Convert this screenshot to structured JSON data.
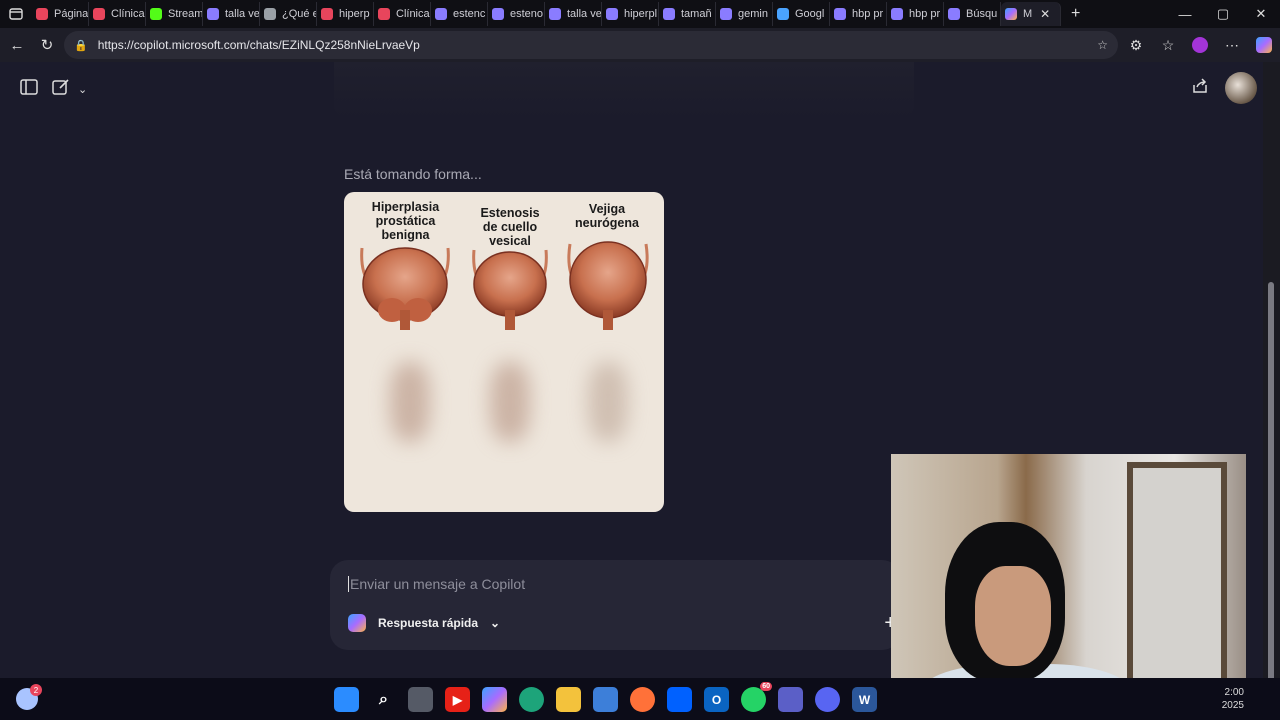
{
  "browser": {
    "tabs": [
      {
        "label": "Página",
        "color": "#e8455c"
      },
      {
        "label": "Clínica",
        "color": "#e8455c"
      },
      {
        "label": "Stream",
        "color": "#53fc18"
      },
      {
        "label": "talla ve",
        "color": "#8a7cff"
      },
      {
        "label": "¿Qué e",
        "color": "#9aa0a6"
      },
      {
        "label": "hiperp",
        "color": "#e8455c"
      },
      {
        "label": "Clínica",
        "color": "#e8455c"
      },
      {
        "label": "estenc",
        "color": "#8a7cff"
      },
      {
        "label": "esteno",
        "color": "#8a7cff"
      },
      {
        "label": "talla ve",
        "color": "#8a7cff"
      },
      {
        "label": "hiperpl",
        "color": "#8a7cff"
      },
      {
        "label": "tamañ",
        "color": "#8a7cff"
      },
      {
        "label": "gemin",
        "color": "#8a7cff"
      },
      {
        "label": "Googl",
        "color": "#4aa3ff"
      },
      {
        "label": "hbp pr",
        "color": "#8a7cff"
      },
      {
        "label": "hbp pr",
        "color": "#8a7cff"
      },
      {
        "label": "Búsqu",
        "color": "#8a7cff"
      }
    ],
    "active_tab": {
      "label": "M",
      "color": "#3ba3ff"
    },
    "url": "https://copilot.microsoft.com/chats/EZiNLQz258nNieLrvaeVp"
  },
  "chat": {
    "status_text": "Está tomando forma...",
    "image_labels": {
      "left": "Hiperplasia prostática benigna",
      "middle": "Estenosis de cuello vesical",
      "right": "Vejiga neurógena"
    },
    "composer_placeholder": "Enviar un mensaje a Copilot",
    "mode_label": "Respuesta rápida"
  },
  "taskbar": {
    "notification_count": "2",
    "whatsapp_badge": "60",
    "time": "2:00",
    "year": "2025"
  }
}
